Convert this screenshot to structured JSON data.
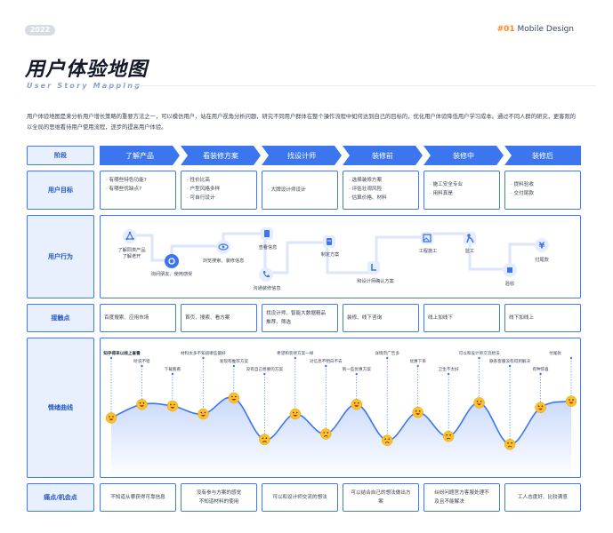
{
  "header": {
    "year": "2022",
    "brand_num": "#01",
    "brand_text": "Mobile Design"
  },
  "title": "用户体验地图",
  "subtitle": "User Story Mapping",
  "intro": "用户体验地图是来分析用户增长策略的重要方法之一，可以模仿用户，站在用户视角分析问题，研究不同用户群体在整个操作流程中如何达到自己的目标的，优化用户体验降低用户学习成本。通过不同人群的研究，更客观的以全局的思维看待用户使用流程，逐步的提高用户体验。",
  "rows": {
    "stage": "阶段",
    "goal": "用户目标",
    "behavior": "用户行为",
    "touch": "接触点",
    "emotion": "情绪曲线",
    "pain": "痛点/机会点"
  },
  "stages": [
    "了解产品",
    "看装修方案",
    "找设计师",
    "装修前",
    "装修中",
    "装修后"
  ],
  "goals": [
    "· 有哪些特色功能?\n· 有哪些优缺点?",
    "· 性价比高\n· 户型风格多样\n· 可自行设计",
    "· 大牌设计师设计",
    "· 选择装修方案\n· 评估壮观风险\n· 估算价格、材料",
    "· 施工安全专业\n· 用料真是",
    "· 提料验收\n· 交付尾款"
  ],
  "behaviors": [
    {
      "icon": "network-icon",
      "label": "了解同类产品\n了解老开"
    },
    {
      "icon": "compass-icon",
      "label": "询问朋友、使用感受"
    },
    {
      "icon": "eye-icon",
      "label": "浏览搜索、装修信息"
    },
    {
      "icon": "document-icon",
      "label": "查看信息"
    },
    {
      "icon": "phone-icon",
      "label": "沟通装修信息"
    },
    {
      "icon": "plan-icon",
      "label": "制定方案"
    },
    {
      "icon": "cursor-icon",
      "label": "和设计师确认方案"
    },
    {
      "icon": "image-icon",
      "label": "工程施工"
    },
    {
      "icon": "worker-icon",
      "label": "监工"
    },
    {
      "icon": "box-icon",
      "label": "验收"
    },
    {
      "icon": "yen-icon",
      "label": "付尾款"
    }
  ],
  "touchpoints": [
    "百度搜索、应用市场",
    "首页、搜索、看方案",
    "找设计师、智能大数据精品\n推荐、筛选",
    "装修、线下咨询",
    "线上加线下",
    "线下加线上"
  ],
  "emotions": [
    {
      "label": "知乎得来以线上查看",
      "mood": "happy",
      "value": 0.45
    },
    {
      "label": "听说不错",
      "mood": "happy",
      "value": 0.62
    },
    {
      "label": "下载看看",
      "mood": "happy",
      "value": 0.6
    },
    {
      "label": "材料太多不知道哪些最好",
      "mood": "happy",
      "value": 0.5
    },
    {
      "label": "发现有推荐方案",
      "mood": "happy",
      "value": 0.7
    },
    {
      "label": "没有自己想要的方案",
      "mood": "sad",
      "value": 0.18
    },
    {
      "label": "希望和装修方案一样",
      "mood": "happy",
      "value": 0.5
    },
    {
      "label": "对信息不明白不去",
      "mood": "sad",
      "value": 0.25
    },
    {
      "label": "到一些优惠方案",
      "mood": "happy",
      "value": 0.62
    },
    {
      "label": "详情页广告多",
      "mood": "sad",
      "value": 0.17
    },
    {
      "label": "优惠下单",
      "mood": "happy",
      "value": 0.52
    },
    {
      "label": "卫生不太好",
      "mood": "sad",
      "value": 0.22
    },
    {
      "label": "可以和设计师交流想法",
      "mood": "happy",
      "value": 0.64
    },
    {
      "label": "联系客服没有得到解决",
      "mood": "sad",
      "value": 0.12
    },
    {
      "label": "有种惊喜",
      "mood": "happy",
      "value": 0.58
    },
    {
      "label": "付尾款",
      "mood": "happy",
      "value": 0.66
    }
  ],
  "pains": [
    "不知道从哪获得可靠信息",
    "没有参与方案的感觉\n不知道材料的使用",
    "可以和设计师交流的想法",
    "可以结合自己的想法做出方\n案",
    "纠纷问题官方客服处理不\n及且不能解决",
    "工人态度好、比较满意"
  ],
  "colors": {
    "accent": "#3b76ee",
    "brand_orange": "#f58a1f",
    "emoji": "#fbc02d",
    "curve_fill": "#dbe6fd"
  }
}
